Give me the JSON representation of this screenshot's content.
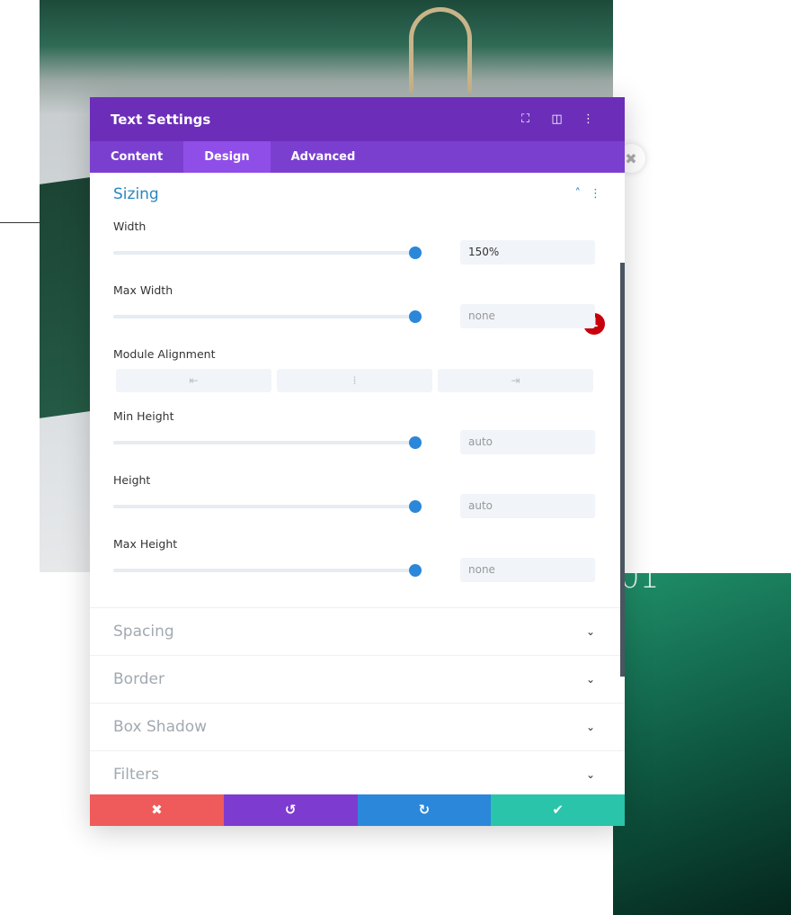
{
  "background": {
    "number": "01"
  },
  "panel": {
    "title": "Text Settings",
    "header_icons": [
      "fullscreen-icon",
      "split-view-icon",
      "more-vertical-icon"
    ],
    "tabs": [
      {
        "label": "Content"
      },
      {
        "label": "Design",
        "active": true
      },
      {
        "label": "Advanced"
      }
    ],
    "section": {
      "title": "Sizing",
      "expanded": true
    },
    "fields": {
      "width": {
        "label": "Width",
        "value": "150%",
        "badge": "1"
      },
      "max_width": {
        "label": "Max Width",
        "placeholder": "none"
      },
      "module_alignment": {
        "label": "Module Alignment",
        "options": [
          "left",
          "center",
          "right"
        ]
      },
      "min_height": {
        "label": "Min Height",
        "placeholder": "auto"
      },
      "height": {
        "label": "Height",
        "placeholder": "auto"
      },
      "max_height": {
        "label": "Max Height",
        "placeholder": "none"
      }
    },
    "collapsed_sections": [
      "Spacing",
      "Border",
      "Box Shadow",
      "Filters"
    ],
    "footer": {
      "cancel": "✖",
      "undo": "↺",
      "redo": "↻",
      "save": "✔"
    },
    "colors": {
      "header": "#6c2eb9",
      "tabs": "#7b3fd0",
      "accent": "#2b87da",
      "cancel": "#ef5a5a",
      "undo": "#7e3bd0",
      "redo": "#2b87da",
      "save": "#29c4a9",
      "badge": "#c8000b"
    }
  }
}
